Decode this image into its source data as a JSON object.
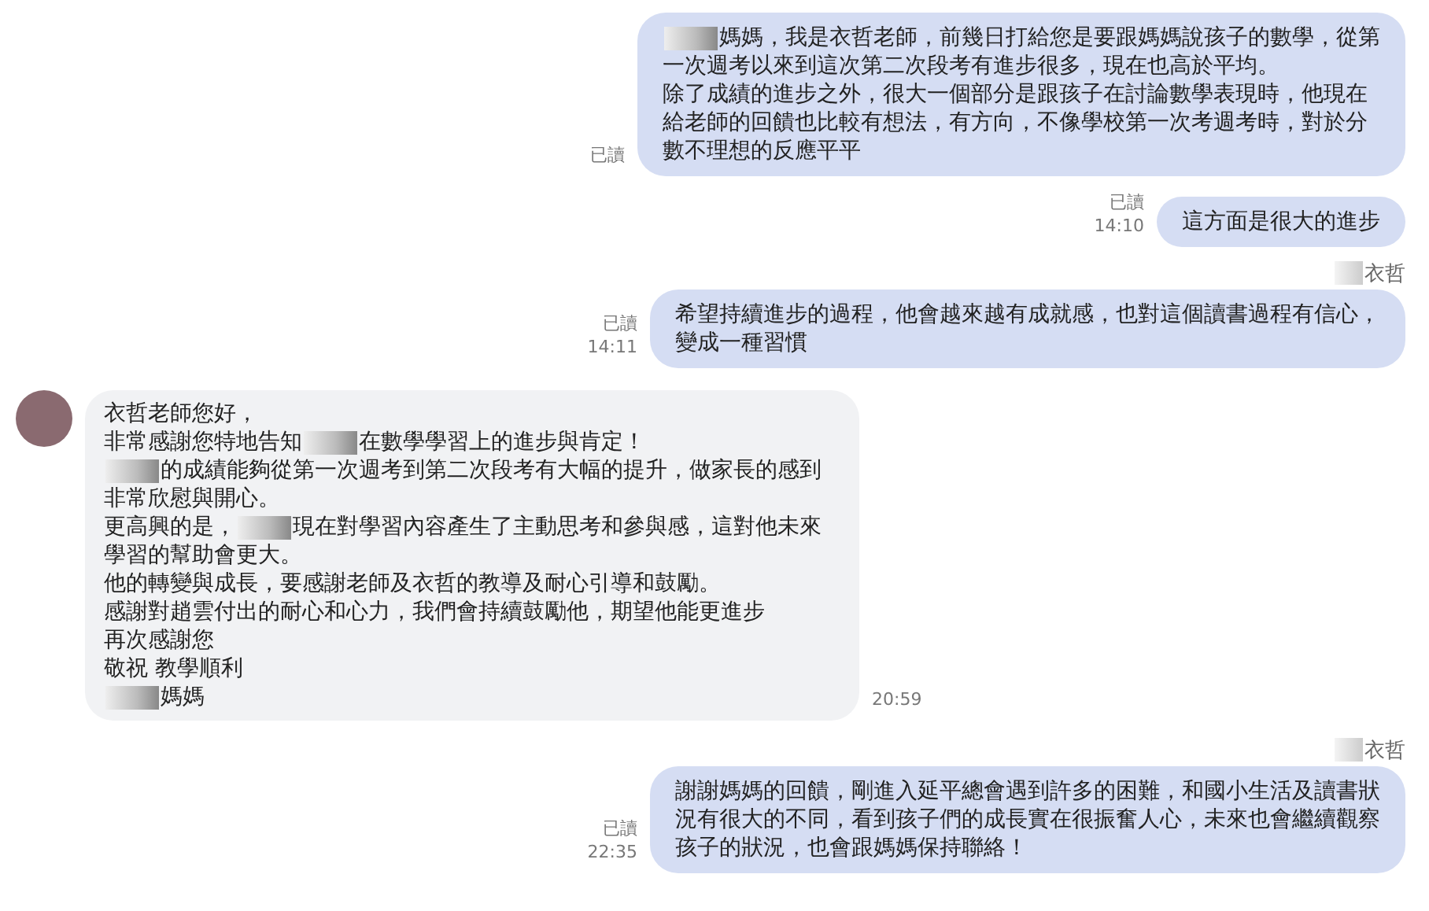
{
  "messages": [
    {
      "kind": "outgoing",
      "status": "已讀",
      "lines": [
        [
          {
            "kind": "blur"
          },
          {
            "kind": "text",
            "text": "媽媽，我是衣哲老師，前幾日打給您是要跟媽媽說孩子的數學，從第"
          }
        ],
        [
          {
            "kind": "text",
            "text": "一次週考以來到這次第二次段考有進步很多，現在也高於平均。"
          }
        ],
        [
          {
            "kind": "text",
            "text": "除了成績的進步之外，很大一個部分是跟孩子在討論數學表現時，他現在"
          }
        ],
        [
          {
            "kind": "text",
            "text": "給老師的回饋也比較有想法，有方向，不像學校第一次考週考時，對於分"
          }
        ],
        [
          {
            "kind": "text",
            "text": "數不理想的反應平平"
          }
        ]
      ]
    },
    {
      "kind": "outgoing",
      "status": "已讀",
      "time": "14:10",
      "lines": [
        [
          {
            "kind": "text",
            "text": "這方面是很大的進步"
          }
        ]
      ]
    },
    {
      "kind": "outgoing",
      "sender": [
        {
          "kind": "blur"
        },
        {
          "kind": "text",
          "text": "衣哲"
        }
      ],
      "status": "已讀",
      "time": "14:11",
      "lines": [
        [
          {
            "kind": "text",
            "text": "希望持續進步的過程，他會越來越有成就感，也對這個讀書過程有信心，"
          }
        ],
        [
          {
            "kind": "text",
            "text": "變成一種習慣"
          }
        ]
      ]
    },
    {
      "kind": "incoming",
      "time": "20:59",
      "lines": [
        [
          {
            "kind": "text",
            "text": "衣哲老師您好，"
          }
        ],
        [
          {
            "kind": "text",
            "text": "非常感謝您特地告知"
          },
          {
            "kind": "blur"
          },
          {
            "kind": "text",
            "text": "在數學學習上的進步與肯定！"
          }
        ],
        [
          {
            "kind": "blur"
          },
          {
            "kind": "text",
            "text": "的成績能夠從第一次週考到第二次段考有大幅的提升，做家長的感到"
          }
        ],
        [
          {
            "kind": "text",
            "text": "非常欣慰與開心。"
          }
        ],
        [
          {
            "kind": "text",
            "text": "更高興的是，"
          },
          {
            "kind": "blur"
          },
          {
            "kind": "text",
            "text": "現在對學習內容產生了主動思考和參與感，這對他未來"
          }
        ],
        [
          {
            "kind": "text",
            "text": "學習的幫助會更大。"
          }
        ],
        [
          {
            "kind": "text",
            "text": "他的轉變與成長，要感謝老師及衣哲的教導及耐心引導和鼓勵。"
          }
        ],
        [
          {
            "kind": "text",
            "text": "感謝對趙雲付出的耐心和心力，我們會持續鼓勵他，期望他能更進步"
          }
        ],
        [
          {
            "kind": "text",
            "text": "再次感謝您"
          }
        ],
        [
          {
            "kind": "text",
            "text": "敬祝 教學順利"
          }
        ],
        [
          {
            "kind": "blur"
          },
          {
            "kind": "text",
            "text": "媽媽"
          }
        ]
      ]
    },
    {
      "kind": "outgoing",
      "sender": [
        {
          "kind": "blur"
        },
        {
          "kind": "text",
          "text": "衣哲"
        }
      ],
      "status": "已讀",
      "time": "22:35",
      "lines": [
        [
          {
            "kind": "text",
            "text": "謝謝媽媽的回饋，剛進入延平總會遇到許多的困難，和國小生活及讀書狀"
          }
        ],
        [
          {
            "kind": "text",
            "text": "況有很大的不同，看到孩子們的成長實在很振奮人心，未來也會繼續觀察"
          }
        ],
        [
          {
            "kind": "text",
            "text": "孩子的狀況，也會跟媽媽保持聯絡！"
          }
        ]
      ]
    }
  ]
}
